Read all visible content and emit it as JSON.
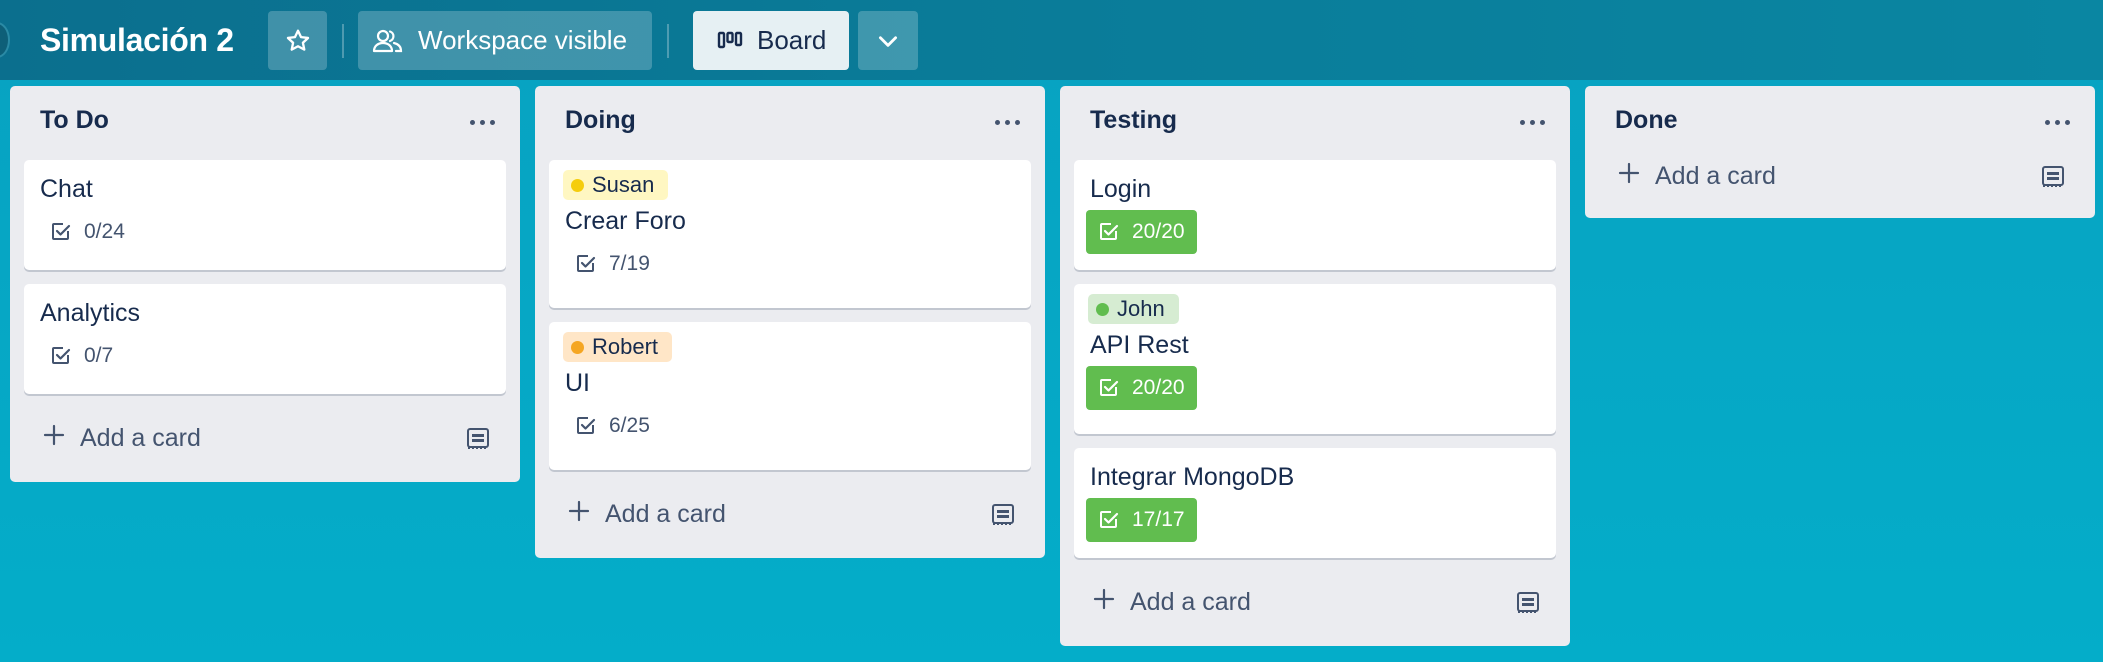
{
  "header": {
    "board_title": "Simulación 2",
    "star_icon": "star-icon",
    "visibility_label": "Workspace visible",
    "visibility_icon": "people-icon",
    "view_label": "Board",
    "view_icon": "board-icon",
    "view_menu_icon": "chevron-down-icon"
  },
  "colors": {
    "header_bg": "#0a7b98",
    "board_bg": "#04adc9",
    "list_bg": "#ebecf0",
    "complete_green": "#61bd4f",
    "label_yellow": "#fff7c2",
    "label_orange": "#ffe6c7",
    "label_green": "#d6ecd2"
  },
  "lists": [
    {
      "title": "To Do",
      "cards": [
        {
          "title": "Chat",
          "checklist": "0/24",
          "complete": false
        },
        {
          "title": "Analytics",
          "checklist": "0/7",
          "complete": false
        }
      ],
      "add_card_label": "Add a card"
    },
    {
      "title": "Doing",
      "cards": [
        {
          "label": "Susan",
          "title": "Crear Foro",
          "checklist": "7/19",
          "complete": false
        },
        {
          "label": "Robert",
          "title": "UI",
          "checklist": "6/25",
          "complete": false
        }
      ],
      "add_card_label": "Add a card"
    },
    {
      "title": "Testing",
      "cards": [
        {
          "title": "Login",
          "checklist": "20/20",
          "complete": true
        },
        {
          "label": "John",
          "title": "API Rest",
          "checklist": "20/20",
          "complete": true
        },
        {
          "title": "Integrar MongoDB",
          "checklist": "17/17",
          "complete": true
        }
      ],
      "add_card_label": "Add a card"
    },
    {
      "title": "Done",
      "cards": [],
      "add_card_label": "Add a card"
    }
  ]
}
